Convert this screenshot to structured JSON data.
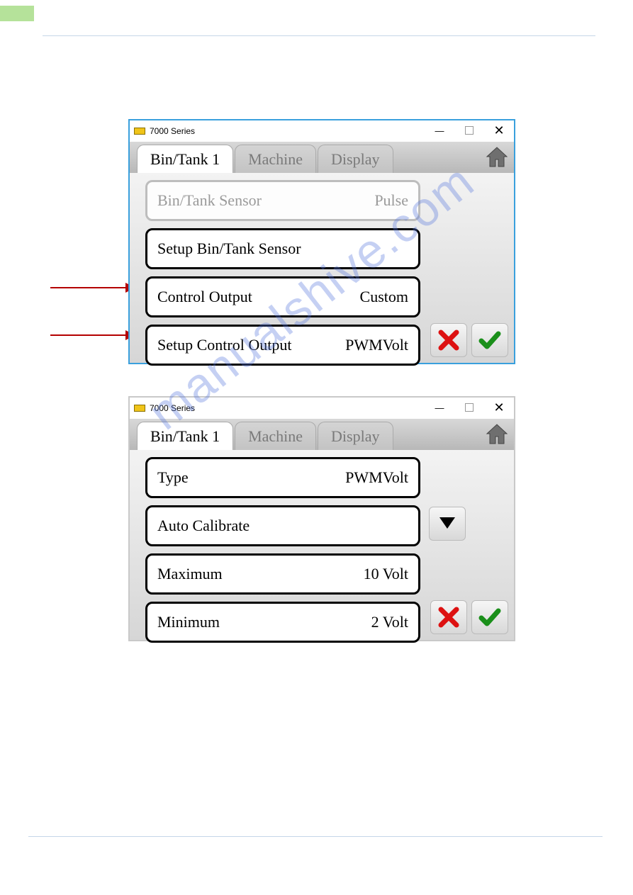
{
  "windows": {
    "title": "7000 Series"
  },
  "tabs": {
    "bin_tank": "Bin/Tank 1",
    "machine": "Machine",
    "display": "Display"
  },
  "screen1": {
    "rows": {
      "sensor": {
        "label": "Bin/Tank Sensor",
        "value": "Pulse"
      },
      "setup_sensor": {
        "label": "Setup Bin/Tank Sensor"
      },
      "control_output": {
        "label": "Control Output",
        "value": "Custom"
      },
      "setup_control_output": {
        "label": "Setup Control Output",
        "value": "PWMVolt"
      }
    }
  },
  "screen2": {
    "rows": {
      "type": {
        "label": "Type",
        "value": "PWMVolt"
      },
      "auto_calibrate": {
        "label": "Auto Calibrate"
      },
      "maximum": {
        "label": "Maximum",
        "value": "10 Volt"
      },
      "minimum": {
        "label": "Minimum",
        "value": "2 Volt"
      }
    }
  },
  "watermark": "manualshive.com"
}
